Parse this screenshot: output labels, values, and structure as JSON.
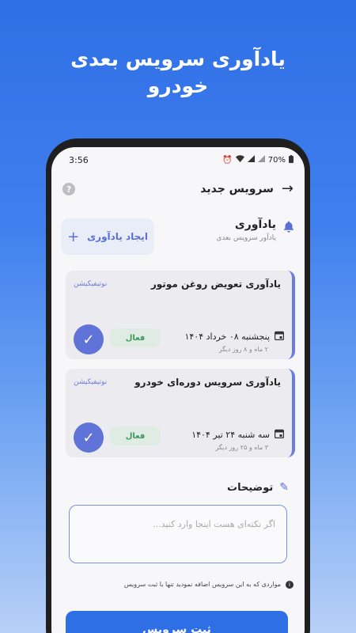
{
  "headline": {
    "line1": "یادآوری سرویس بعدی",
    "line2": "خودرو"
  },
  "status_bar": {
    "time": "3:56",
    "battery": "70%",
    "icons": [
      "alarm-icon",
      "wifi-icon",
      "signal-icon",
      "signal-icon",
      "battery-icon"
    ]
  },
  "appbar": {
    "title": "سرویس جدید",
    "back_icon": "arrow-right",
    "help_icon": "?"
  },
  "reminders": {
    "title": "یادآوری",
    "subtitle": "یادآور سرویس بعدی",
    "create_label": "ایجاد یادآوری",
    "create_icon": "+",
    "items": [
      {
        "title": "یادآوری تعویض روغن موتور",
        "tag": "نوتیفیکیشن",
        "date": "پنجشنبه ۰۸ خرداد ۱۴۰۴",
        "remaining": "۲ ماه و ۸ روز دیگر",
        "status": "فعال"
      },
      {
        "title": "یادآوری سرویس دوره‌ای خودرو",
        "tag": "نوتیفیکیشن",
        "date": "سه شنبه ۲۴ تیر ۱۴۰۴",
        "remaining": "۳ ماه و ۲۵ روز دیگر",
        "status": "فعال"
      }
    ]
  },
  "description": {
    "title": "توضیحات",
    "placeholder": "اگر نکته‌ای هست اینجا وارد کنید..."
  },
  "note": {
    "text": "مواردی که به این سرویس اضافه نمودید تنها با ثبت سرویس"
  },
  "submit_label": "ثبت سرویس",
  "colors": {
    "primary": "#2f6fe6",
    "accent": "#5f73d8",
    "active_bg": "#dfece3",
    "active_text": "#3c9a5c"
  }
}
